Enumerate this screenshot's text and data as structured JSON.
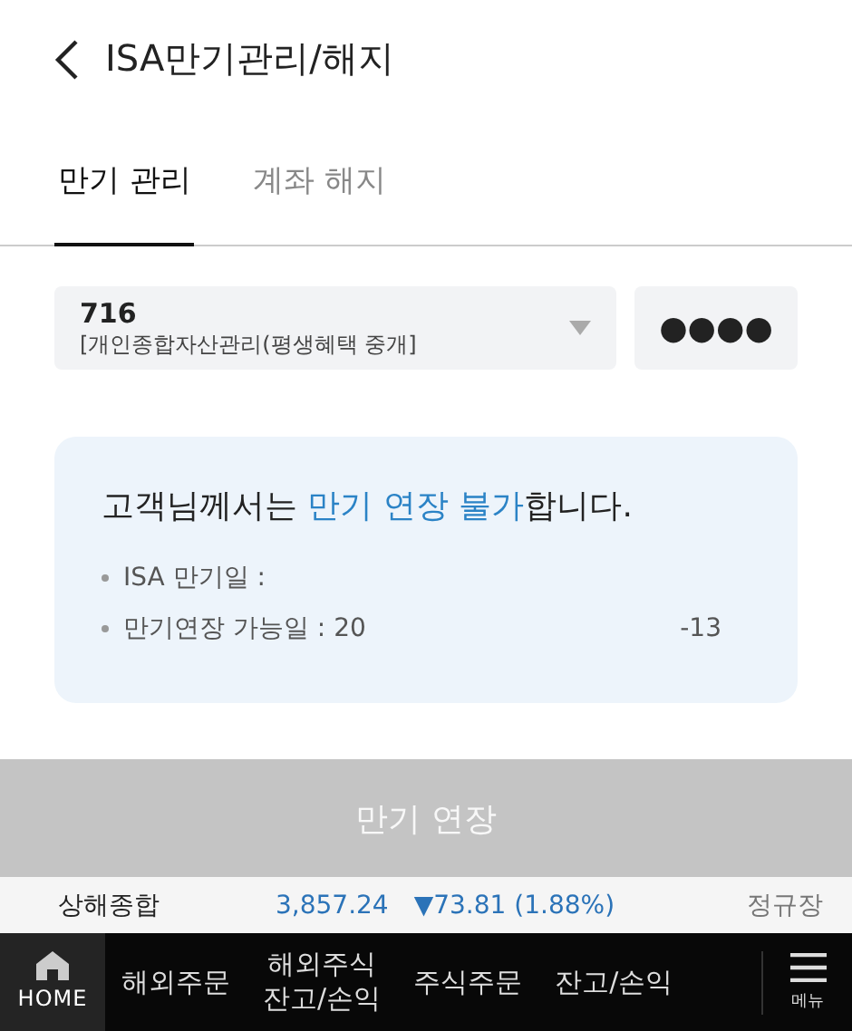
{
  "header": {
    "title": "ISA만기관리/해지"
  },
  "tabs": [
    {
      "label": "만기 관리",
      "selected": true
    },
    {
      "label": "계좌 해지",
      "selected": false
    }
  ],
  "account": {
    "number": "716",
    "name": "[개인종합자산관리(평생혜택 중개]",
    "password_mask": "●●●●"
  },
  "notice": {
    "before": "고객님께서는 ",
    "highlight": "만기 연장 불가",
    "after": "합니다.",
    "items": [
      {
        "label": "ISA 만기일 :"
      },
      {
        "label": "만기연장 가능일 : 20",
        "value": "-13"
      }
    ]
  },
  "action_button": {
    "label": "만기 연장",
    "disabled": true
  },
  "ticker": {
    "index": "상해종합",
    "value": "3,857.24",
    "change": "▼73.81 (1.88%)",
    "session": "정규장"
  },
  "bottom_nav": {
    "home": "HOME",
    "items": [
      {
        "label": "해외주문"
      },
      {
        "label": "해외주식\n잔고/손익"
      },
      {
        "label": "주식주문"
      },
      {
        "label": "잔고/손익"
      }
    ],
    "menu": "메뉴"
  }
}
